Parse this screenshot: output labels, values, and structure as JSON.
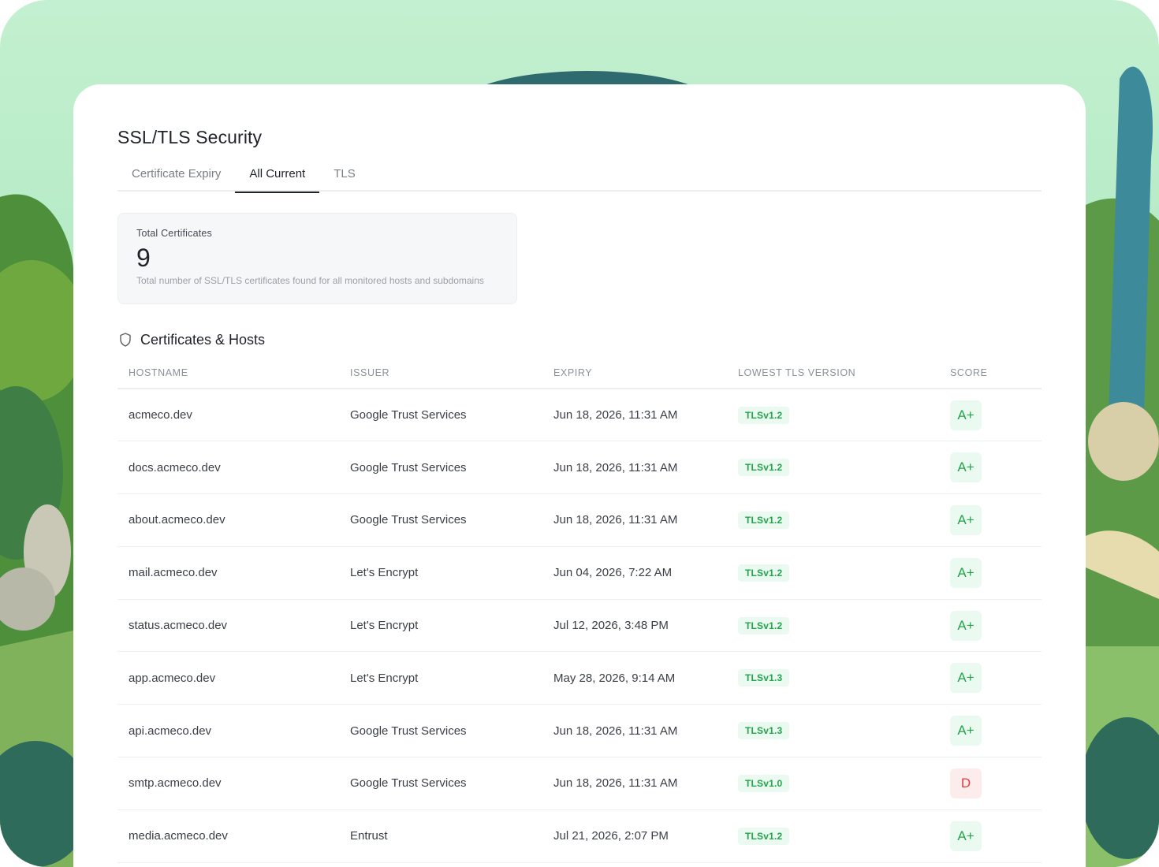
{
  "page": {
    "title": "SSL/TLS Security"
  },
  "tabs": [
    {
      "label": "Certificate Expiry",
      "active": false
    },
    {
      "label": "All Current",
      "active": true
    },
    {
      "label": "TLS",
      "active": false
    }
  ],
  "stat": {
    "label": "Total Certificates",
    "value": "9",
    "description": "Total number of SSL/TLS certificates found for all monitored hosts and subdomains"
  },
  "section": {
    "title": "Certificates & Hosts",
    "icon": "shield-icon"
  },
  "table": {
    "headers": [
      "HOSTNAME",
      "ISSUER",
      "EXPIRY",
      "LOWEST TLS VERSION",
      "SCORE"
    ],
    "rows": [
      {
        "hostname": "acmeco.dev",
        "issuer": "Google Trust Services",
        "expiry": "Jun 18, 2026, 11:31 AM",
        "tls": "TLSv1.2",
        "score": "A+",
        "status": "good"
      },
      {
        "hostname": "docs.acmeco.dev",
        "issuer": "Google Trust Services",
        "expiry": "Jun 18, 2026, 11:31 AM",
        "tls": "TLSv1.2",
        "score": "A+",
        "status": "good"
      },
      {
        "hostname": "about.acmeco.dev",
        "issuer": "Google Trust Services",
        "expiry": "Jun 18, 2026, 11:31 AM",
        "tls": "TLSv1.2",
        "score": "A+",
        "status": "good"
      },
      {
        "hostname": "mail.acmeco.dev",
        "issuer": "Let's Encrypt",
        "expiry": "Jun 04, 2026, 7:22 AM",
        "tls": "TLSv1.2",
        "score": "A+",
        "status": "good"
      },
      {
        "hostname": "status.acmeco.dev",
        "issuer": "Let's Encrypt",
        "expiry": "Jul 12, 2026, 3:48 PM",
        "tls": "TLSv1.2",
        "score": "A+",
        "status": "good"
      },
      {
        "hostname": "app.acmeco.dev",
        "issuer": "Let's Encrypt",
        "expiry": "May 28, 2026, 9:14 AM",
        "tls": "TLSv1.3",
        "score": "A+",
        "status": "good"
      },
      {
        "hostname": "api.acmeco.dev",
        "issuer": "Google Trust Services",
        "expiry": "Jun 18, 2026, 11:31 AM",
        "tls": "TLSv1.3",
        "score": "A+",
        "status": "good"
      },
      {
        "hostname": "smtp.acmeco.dev",
        "issuer": "Google Trust Services",
        "expiry": "Jun 18, 2026, 11:31 AM",
        "tls": "TLSv1.0",
        "score": "D",
        "status": "bad"
      },
      {
        "hostname": "media.acmeco.dev",
        "issuer": "Entrust",
        "expiry": "Jul 21, 2026, 2:07 PM",
        "tls": "TLSv1.2",
        "score": "A+",
        "status": "good"
      }
    ]
  },
  "colors": {
    "good": "#23a34a",
    "good_bg": "#ebfaf0",
    "bad": "#e23b3b",
    "bad_bg": "#fdecec"
  }
}
